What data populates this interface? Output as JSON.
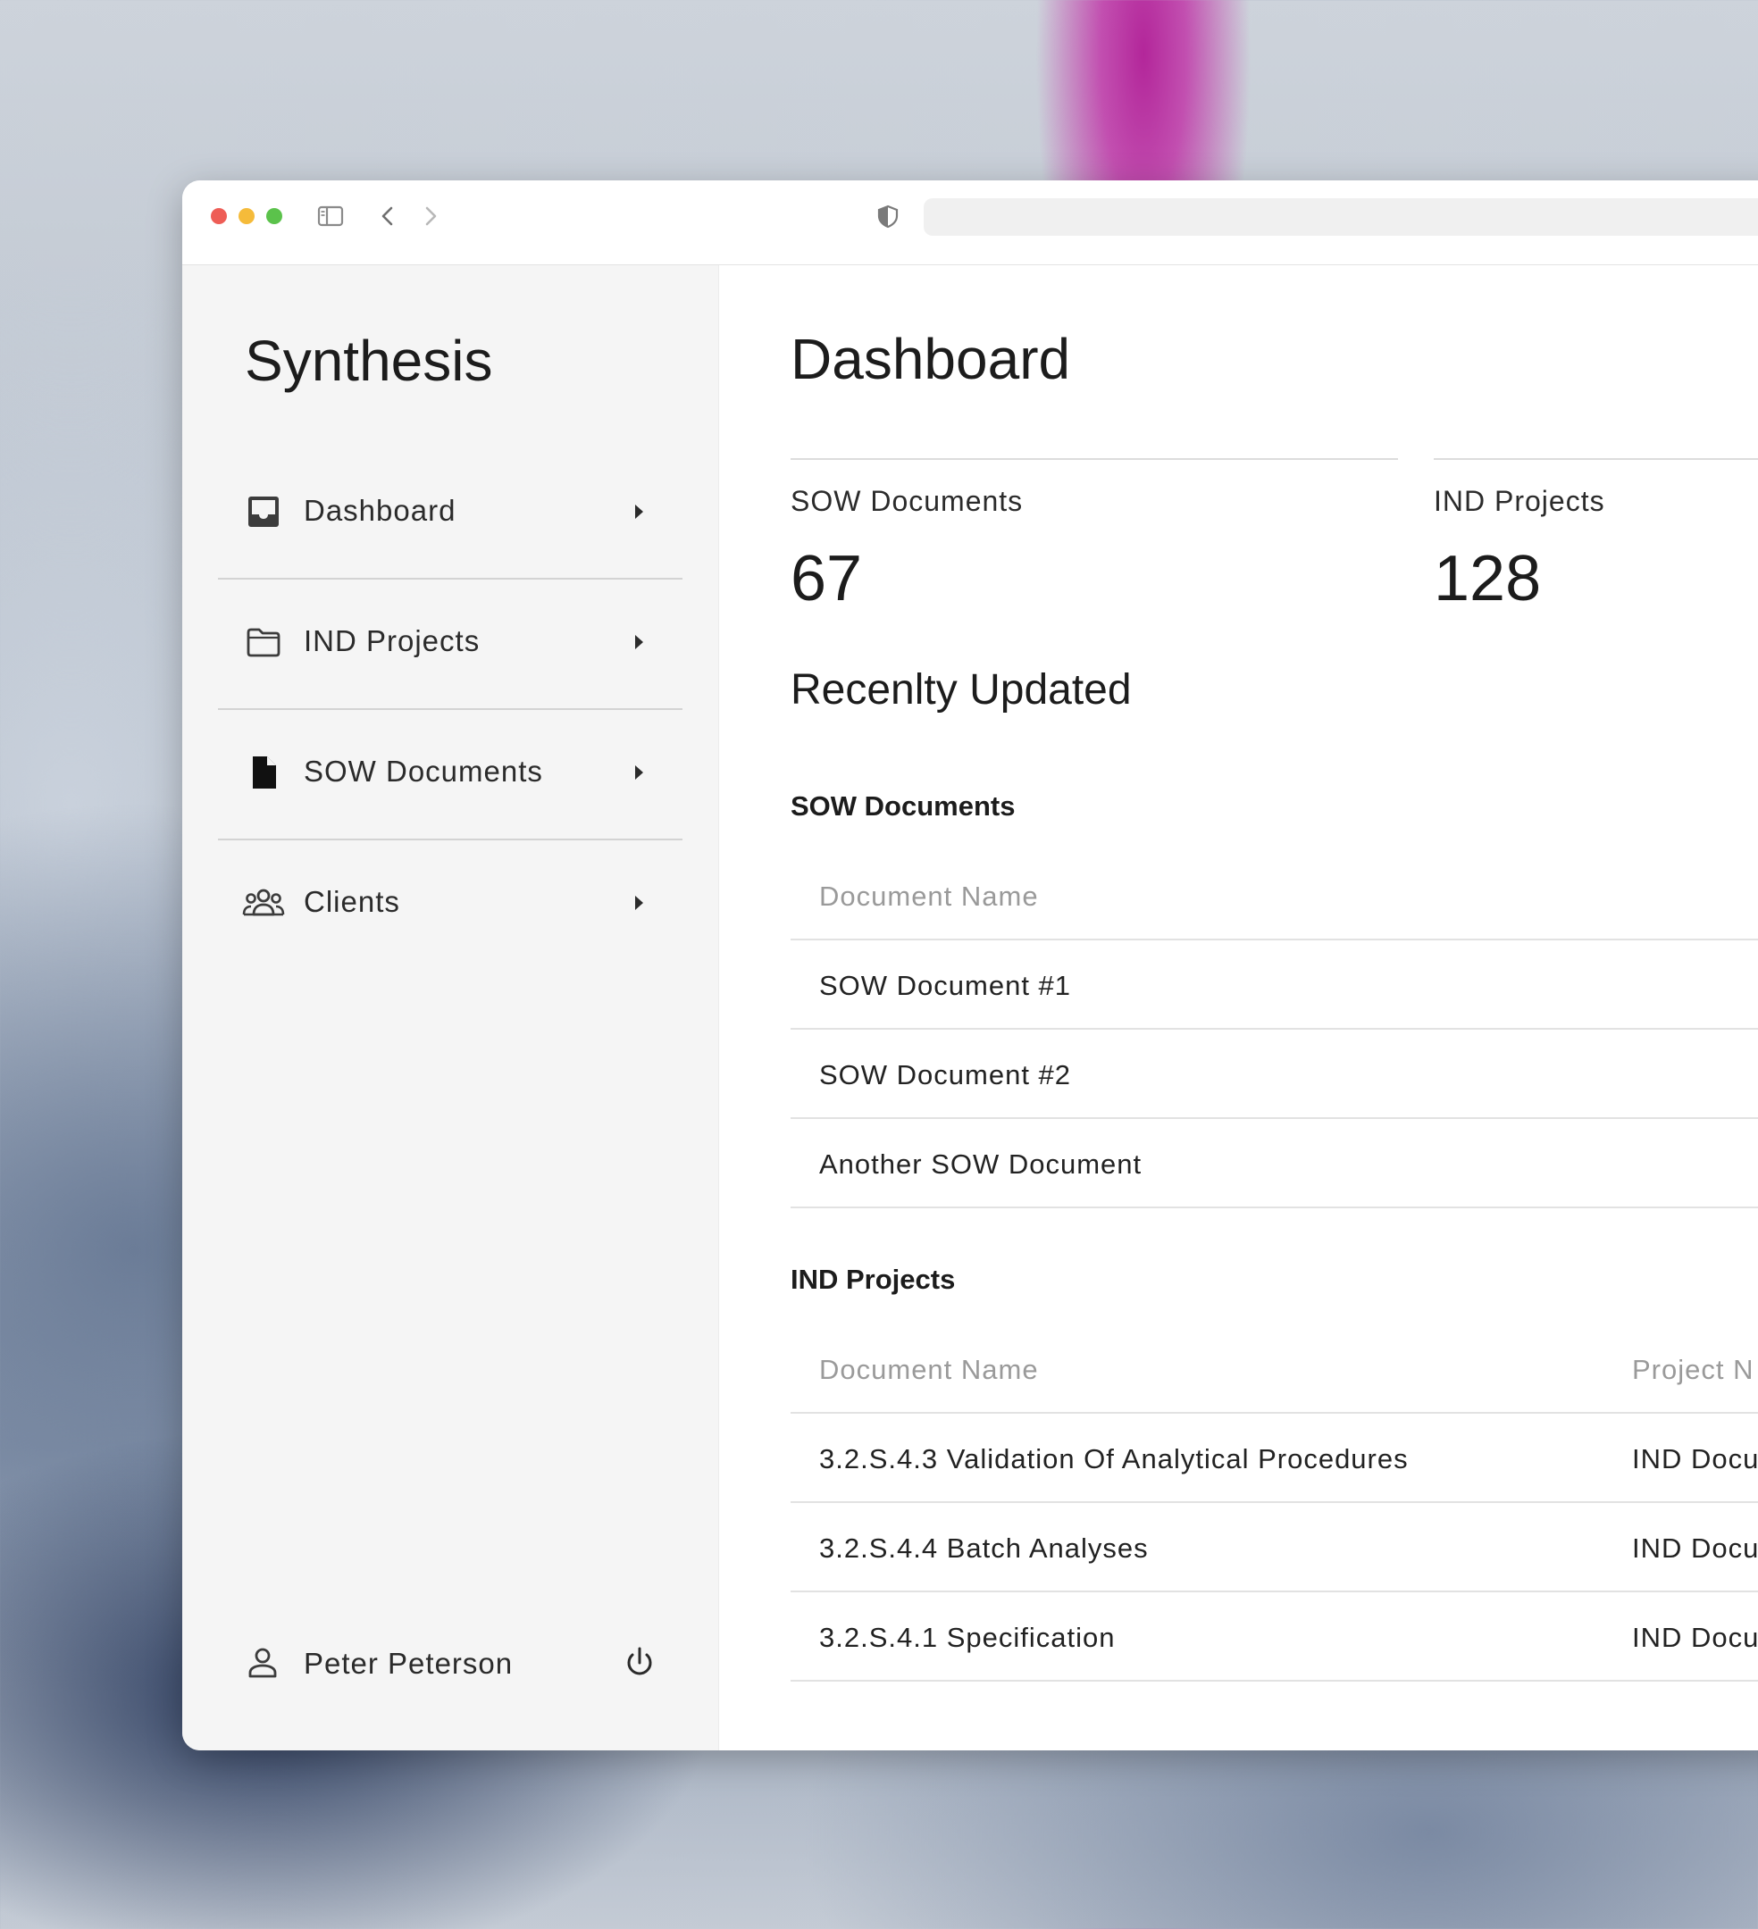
{
  "sidebar": {
    "brand": "Synthesis",
    "items": [
      {
        "label": "Dashboard",
        "icon": "inbox-icon"
      },
      {
        "label": "IND Projects",
        "icon": "folder-icon"
      },
      {
        "label": "SOW Documents",
        "icon": "document-icon"
      },
      {
        "label": "Clients",
        "icon": "people-icon"
      }
    ],
    "user": {
      "name": "Peter Peterson",
      "icon": "user-icon",
      "action_icon": "power-icon"
    }
  },
  "main": {
    "title": "Dashboard",
    "stats": [
      {
        "label": "SOW Documents",
        "value": "67"
      },
      {
        "label": "IND Projects",
        "value": "128"
      }
    ],
    "recent_title": "Recenlty Updated",
    "sow_table": {
      "title": "SOW Documents",
      "columns": [
        "Document Name"
      ],
      "rows": [
        "SOW Document #1",
        "SOW Document #2",
        "Another SOW Document"
      ]
    },
    "ind_table": {
      "title": "IND Projects",
      "columns": [
        "Document Name",
        "Project N"
      ],
      "rows": [
        [
          "3.2.S.4.3 Validation Of Analytical Procedures",
          "IND Docu"
        ],
        [
          "3.2.S.4.4 Batch Analyses",
          "IND Docu"
        ],
        [
          "3.2.S.4.1 Specification",
          "IND Docu"
        ]
      ]
    }
  }
}
